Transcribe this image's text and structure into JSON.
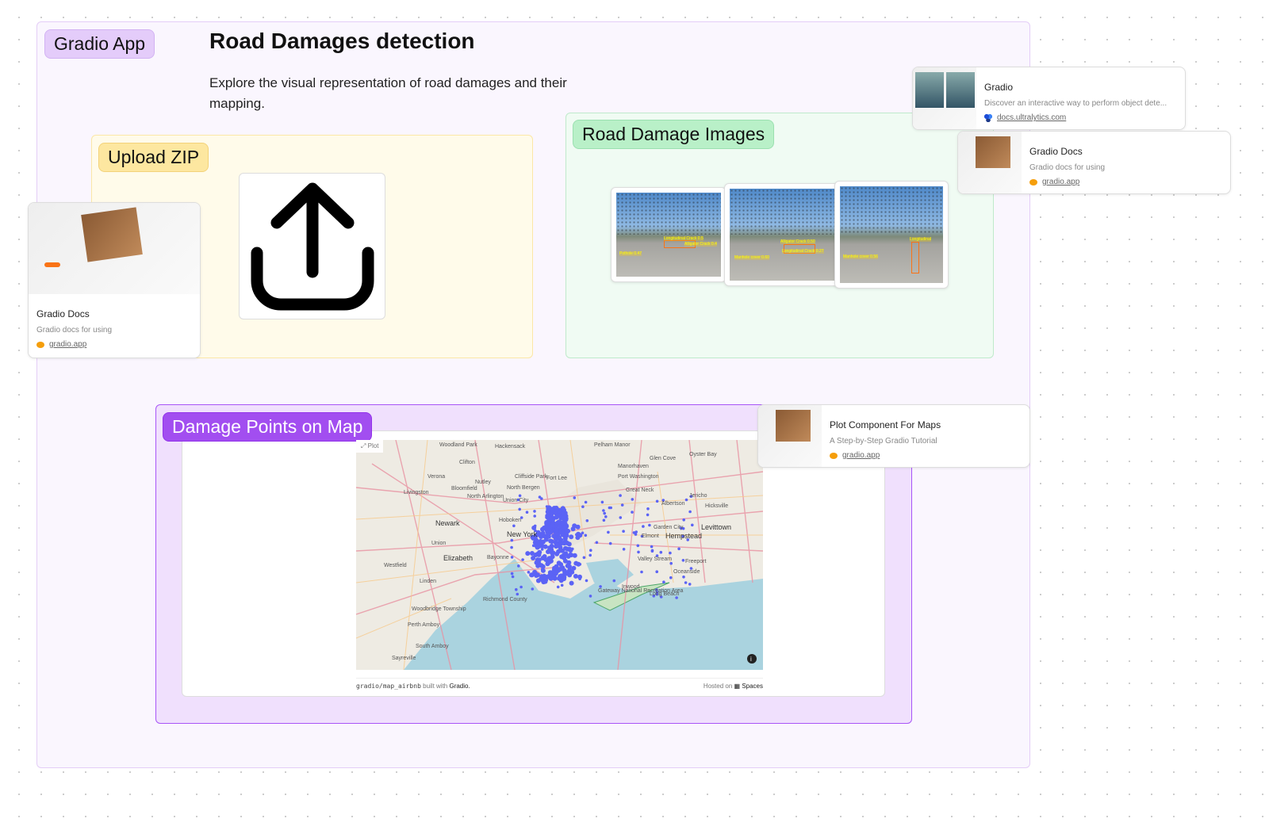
{
  "app": {
    "tag": "Gradio App",
    "title": "Road Damages detection",
    "description": "Explore the visual representation of road damages and their mapping."
  },
  "upload": {
    "tag": "Upload ZIP",
    "icon": "upload-icon"
  },
  "images": {
    "tag": "Road Damage Images",
    "photos": [
      {
        "labels": [
          "Longitudinal Crack 0.5",
          "Pothole 0.47",
          "Alligator Crack 0.4"
        ]
      },
      {
        "labels": [
          "Alligator Crack 0.50",
          "Manhole cover 0.60",
          "Longitudinal Crack 0.27"
        ]
      },
      {
        "labels": [
          "Longitudinal",
          "Manhole cover 0.56"
        ]
      }
    ]
  },
  "map": {
    "tag": "Damage Points on Map",
    "plot_label": "Plot",
    "place_labels": [
      "Woodland Park",
      "Hackensack",
      "Pelham Manor",
      "Oyster Bay",
      "Glen Cove",
      "Clifton",
      "Fort Lee",
      "Manorhaven",
      "Port Washington",
      "Verona",
      "Nutley",
      "Cliffside Park",
      "Bloomfield",
      "North Bergen",
      "Great Neck",
      "Livingston",
      "North Arlington",
      "Union City",
      "Jericho",
      "Albertson",
      "Hicksville",
      "Newark",
      "Hoboken",
      "Garden City",
      "Levittown",
      "New York",
      "Elmont",
      "Hempstead",
      "Union",
      "Elizabeth",
      "Bayonne",
      "Valley Stream",
      "Freeport",
      "Westfield",
      "Oceanside",
      "Linden",
      "Inwood",
      "Long Beach",
      "Woodbridge Township",
      "Perth Amboy",
      "South Amboy",
      "Sayreville",
      "Gateway National Recreation Area",
      "Richmond County"
    ],
    "point_color": "#5b63f5",
    "footer_left_code": "gradio/map_airbnb",
    "footer_left_text": " built with ",
    "footer_left_brand": "Gradio.",
    "footer_right_text": "Hosted on",
    "footer_right_brand": "Spaces"
  },
  "links": [
    {
      "title": "Gradio Docs",
      "desc": "Gradio docs for using",
      "domain": "gradio.app"
    },
    {
      "title": "Gradio",
      "desc": "Discover an interactive way to perform object dete...",
      "domain": "docs.ultralytics.com"
    },
    {
      "title": "Gradio Docs",
      "desc": "Gradio docs for using",
      "domain": "gradio.app"
    },
    {
      "title": "Plot Component For Maps",
      "desc": "A Step-by-Step Gradio Tutorial",
      "domain": "gradio.app"
    }
  ],
  "colors": {
    "frame": "#e0c8f5",
    "upload": "#fde7a0",
    "images": "#b9f0c8",
    "map": "#a24ef0"
  }
}
